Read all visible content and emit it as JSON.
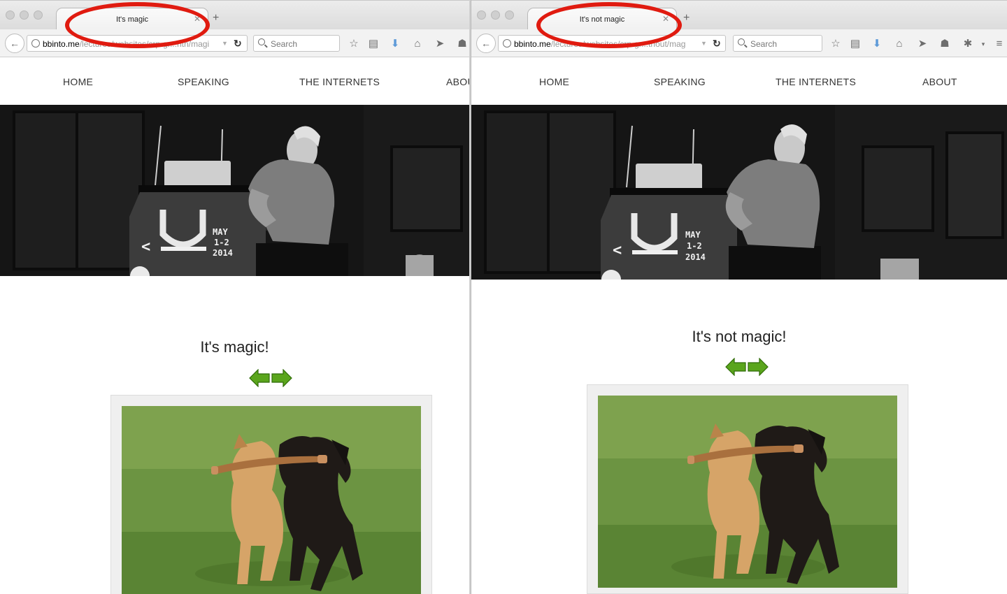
{
  "left_window": {
    "tab_title": "It's magic",
    "url_host": "bbinto.me",
    "url_path": "/lectures/websites/crp-gr...ntn/magi",
    "search_placeholder": "Search",
    "nav": [
      "HOME",
      "SPEAKING",
      "THE INTERNETS",
      "ABOU"
    ],
    "hero_sign": [
      "MAY",
      "1-2",
      "2014"
    ],
    "heading": "It's magic!"
  },
  "right_window": {
    "tab_title": "It's not magic",
    "url_host": "bbinto.me",
    "url_path": "/lectures/websites/crp-gr...thout/mag",
    "search_placeholder": "Search",
    "nav": [
      "HOME",
      "SPEAKING",
      "THE INTERNETS",
      "ABOUT"
    ],
    "hero_sign": [
      "MAY",
      "1-2",
      "2014"
    ],
    "heading": "It's not magic!"
  },
  "colors": {
    "annotation": "#e01b10",
    "arrow_green": "#5aa51c",
    "hero_bg": "#161616"
  },
  "icons": [
    "back-arrow-icon",
    "globe-icon",
    "reload-icon",
    "search-icon",
    "star-icon",
    "reading-list-icon",
    "download-icon",
    "home-icon",
    "share-icon",
    "ghost-icon",
    "extension-icon",
    "menu-icon",
    "close-icon",
    "new-tab-icon"
  ]
}
